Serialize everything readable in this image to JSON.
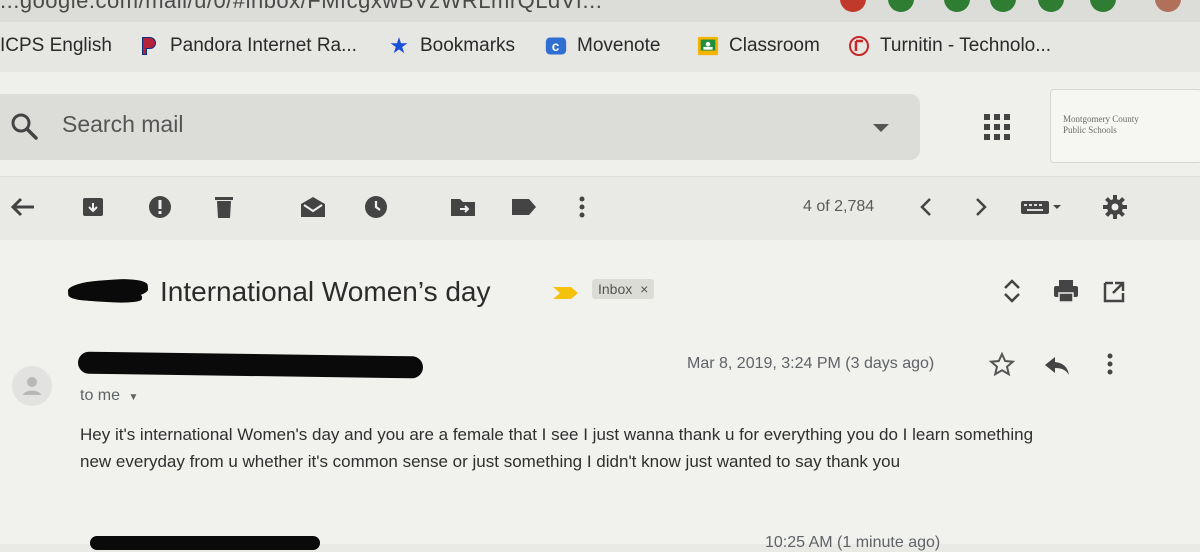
{
  "browser": {
    "url_partial": "...google.com/mail/u/0/#inbox/FMfcgxwBVzWRLmrQLdVf...",
    "bookmarks": [
      {
        "label": "ICPS English",
        "icon": "blank"
      },
      {
        "label": "Pandora Internet Ra...",
        "icon": "pandora-icon"
      },
      {
        "label": "Bookmarks",
        "icon": "star-icon"
      },
      {
        "label": "Movenote",
        "icon": "movenote-icon"
      },
      {
        "label": "Classroom",
        "icon": "classroom-icon"
      },
      {
        "label": "Turnitin - Technolo...",
        "icon": "turnitin-icon"
      }
    ]
  },
  "header": {
    "search_placeholder": "Search mail",
    "org_logo_text_1": "Montgomery County",
    "org_logo_text_2": "Public Schools"
  },
  "toolbar": {
    "page_count": "4 of 2,784"
  },
  "message": {
    "subject": "International Women’s day",
    "label_chip": "Inbox",
    "label_chip_close": "×",
    "date": "Mar 8, 2019, 3:24 PM (3 days ago)",
    "recipient": "to me",
    "body_line_1": "Hey it's international Women's day and you are a female that I see I just wanna thank u for everything you do I learn something",
    "body_line_2": "new everyday from u whether it's common sense or just something I didn't know just wanted to say thank you",
    "next_message_time": "10:25 AM (1 minute ago)"
  },
  "colors": {
    "accent_blue": "#1a73e8",
    "important_marker": "#f4c20d",
    "redaction": "#0a0a0a"
  }
}
